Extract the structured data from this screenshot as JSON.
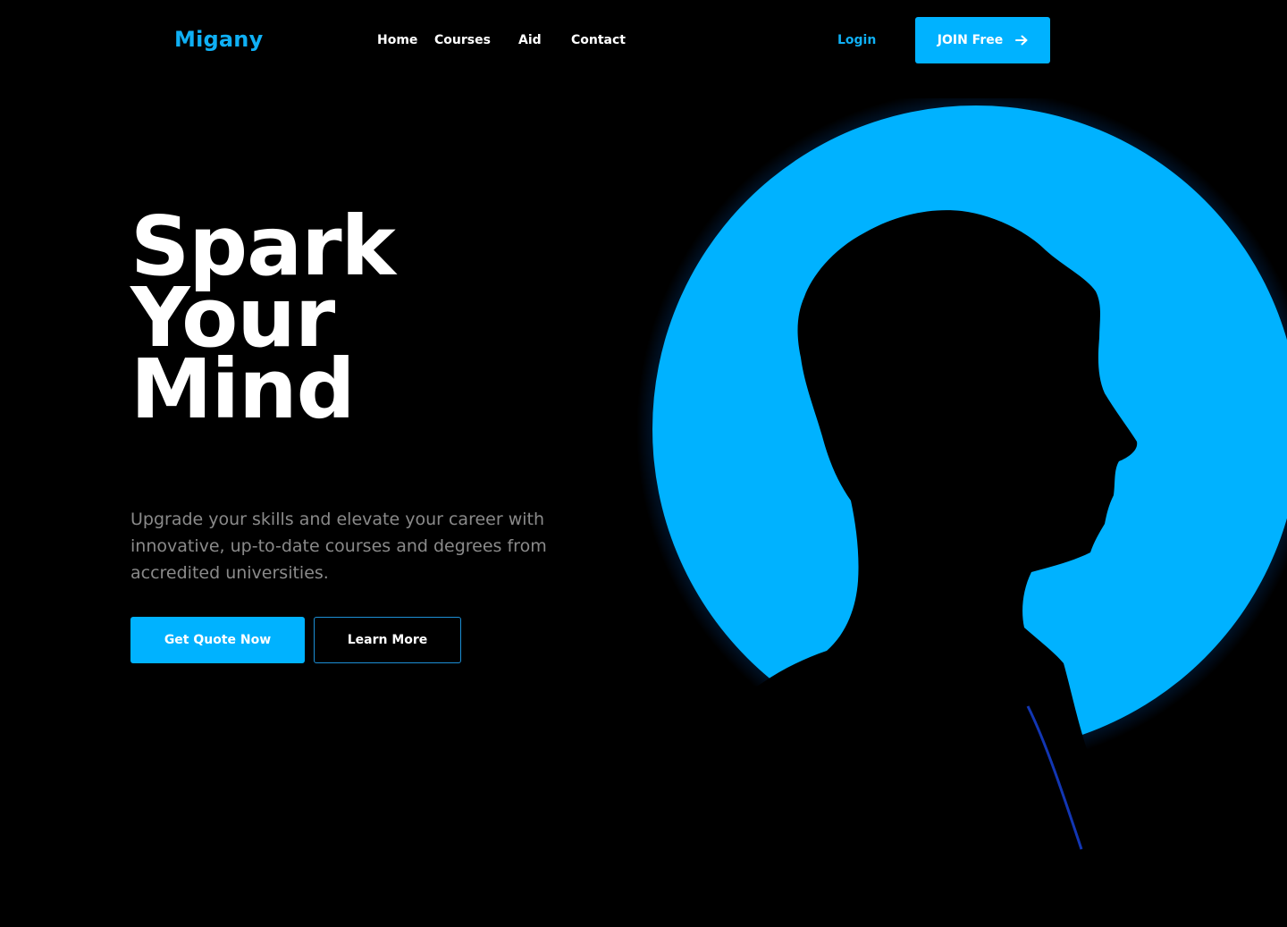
{
  "brand": {
    "name": "Migany",
    "accent_color": "#00b2ff"
  },
  "nav": {
    "items": [
      {
        "label": "Home"
      },
      {
        "label": "Courses"
      },
      {
        "label": "Aid"
      },
      {
        "label": "Contact"
      }
    ],
    "login_label": "Login",
    "join_label": "JOIN Free",
    "join_icon": "arrow-right-icon"
  },
  "hero": {
    "headline": [
      "Spark",
      "Your",
      "Mind"
    ],
    "subtitle": "Upgrade your skills and elevate your career with innovative, up-to-date courses and degrees from accredited universities.",
    "primary_cta": "Get Quote Now",
    "secondary_cta": "Learn More",
    "image": "man-silhouette-blue-circle"
  }
}
